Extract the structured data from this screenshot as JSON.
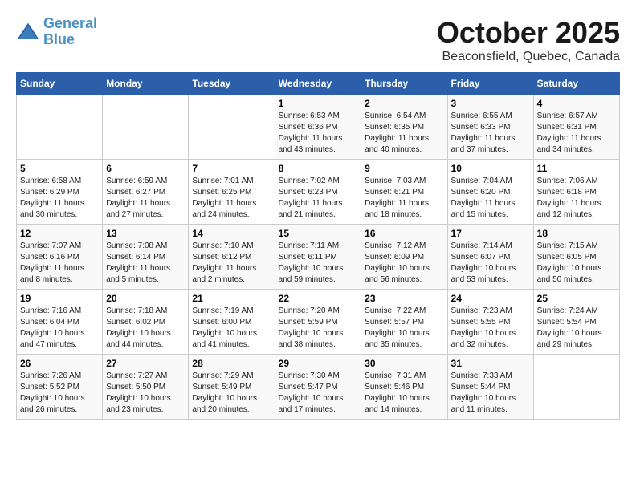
{
  "header": {
    "logo_line1": "General",
    "logo_line2": "Blue",
    "month": "October 2025",
    "location": "Beaconsfield, Quebec, Canada"
  },
  "weekdays": [
    "Sunday",
    "Monday",
    "Tuesday",
    "Wednesday",
    "Thursday",
    "Friday",
    "Saturday"
  ],
  "weeks": [
    [
      {
        "day": "",
        "info": ""
      },
      {
        "day": "",
        "info": ""
      },
      {
        "day": "",
        "info": ""
      },
      {
        "day": "1",
        "info": "Sunrise: 6:53 AM\nSunset: 6:36 PM\nDaylight: 11 hours\nand 43 minutes."
      },
      {
        "day": "2",
        "info": "Sunrise: 6:54 AM\nSunset: 6:35 PM\nDaylight: 11 hours\nand 40 minutes."
      },
      {
        "day": "3",
        "info": "Sunrise: 6:55 AM\nSunset: 6:33 PM\nDaylight: 11 hours\nand 37 minutes."
      },
      {
        "day": "4",
        "info": "Sunrise: 6:57 AM\nSunset: 6:31 PM\nDaylight: 11 hours\nand 34 minutes."
      }
    ],
    [
      {
        "day": "5",
        "info": "Sunrise: 6:58 AM\nSunset: 6:29 PM\nDaylight: 11 hours\nand 30 minutes."
      },
      {
        "day": "6",
        "info": "Sunrise: 6:59 AM\nSunset: 6:27 PM\nDaylight: 11 hours\nand 27 minutes."
      },
      {
        "day": "7",
        "info": "Sunrise: 7:01 AM\nSunset: 6:25 PM\nDaylight: 11 hours\nand 24 minutes."
      },
      {
        "day": "8",
        "info": "Sunrise: 7:02 AM\nSunset: 6:23 PM\nDaylight: 11 hours\nand 21 minutes."
      },
      {
        "day": "9",
        "info": "Sunrise: 7:03 AM\nSunset: 6:21 PM\nDaylight: 11 hours\nand 18 minutes."
      },
      {
        "day": "10",
        "info": "Sunrise: 7:04 AM\nSunset: 6:20 PM\nDaylight: 11 hours\nand 15 minutes."
      },
      {
        "day": "11",
        "info": "Sunrise: 7:06 AM\nSunset: 6:18 PM\nDaylight: 11 hours\nand 12 minutes."
      }
    ],
    [
      {
        "day": "12",
        "info": "Sunrise: 7:07 AM\nSunset: 6:16 PM\nDaylight: 11 hours\nand 8 minutes."
      },
      {
        "day": "13",
        "info": "Sunrise: 7:08 AM\nSunset: 6:14 PM\nDaylight: 11 hours\nand 5 minutes."
      },
      {
        "day": "14",
        "info": "Sunrise: 7:10 AM\nSunset: 6:12 PM\nDaylight: 11 hours\nand 2 minutes."
      },
      {
        "day": "15",
        "info": "Sunrise: 7:11 AM\nSunset: 6:11 PM\nDaylight: 10 hours\nand 59 minutes."
      },
      {
        "day": "16",
        "info": "Sunrise: 7:12 AM\nSunset: 6:09 PM\nDaylight: 10 hours\nand 56 minutes."
      },
      {
        "day": "17",
        "info": "Sunrise: 7:14 AM\nSunset: 6:07 PM\nDaylight: 10 hours\nand 53 minutes."
      },
      {
        "day": "18",
        "info": "Sunrise: 7:15 AM\nSunset: 6:05 PM\nDaylight: 10 hours\nand 50 minutes."
      }
    ],
    [
      {
        "day": "19",
        "info": "Sunrise: 7:16 AM\nSunset: 6:04 PM\nDaylight: 10 hours\nand 47 minutes."
      },
      {
        "day": "20",
        "info": "Sunrise: 7:18 AM\nSunset: 6:02 PM\nDaylight: 10 hours\nand 44 minutes."
      },
      {
        "day": "21",
        "info": "Sunrise: 7:19 AM\nSunset: 6:00 PM\nDaylight: 10 hours\nand 41 minutes."
      },
      {
        "day": "22",
        "info": "Sunrise: 7:20 AM\nSunset: 5:59 PM\nDaylight: 10 hours\nand 38 minutes."
      },
      {
        "day": "23",
        "info": "Sunrise: 7:22 AM\nSunset: 5:57 PM\nDaylight: 10 hours\nand 35 minutes."
      },
      {
        "day": "24",
        "info": "Sunrise: 7:23 AM\nSunset: 5:55 PM\nDaylight: 10 hours\nand 32 minutes."
      },
      {
        "day": "25",
        "info": "Sunrise: 7:24 AM\nSunset: 5:54 PM\nDaylight: 10 hours\nand 29 minutes."
      }
    ],
    [
      {
        "day": "26",
        "info": "Sunrise: 7:26 AM\nSunset: 5:52 PM\nDaylight: 10 hours\nand 26 minutes."
      },
      {
        "day": "27",
        "info": "Sunrise: 7:27 AM\nSunset: 5:50 PM\nDaylight: 10 hours\nand 23 minutes."
      },
      {
        "day": "28",
        "info": "Sunrise: 7:29 AM\nSunset: 5:49 PM\nDaylight: 10 hours\nand 20 minutes."
      },
      {
        "day": "29",
        "info": "Sunrise: 7:30 AM\nSunset: 5:47 PM\nDaylight: 10 hours\nand 17 minutes."
      },
      {
        "day": "30",
        "info": "Sunrise: 7:31 AM\nSunset: 5:46 PM\nDaylight: 10 hours\nand 14 minutes."
      },
      {
        "day": "31",
        "info": "Sunrise: 7:33 AM\nSunset: 5:44 PM\nDaylight: 10 hours\nand 11 minutes."
      },
      {
        "day": "",
        "info": ""
      }
    ]
  ]
}
